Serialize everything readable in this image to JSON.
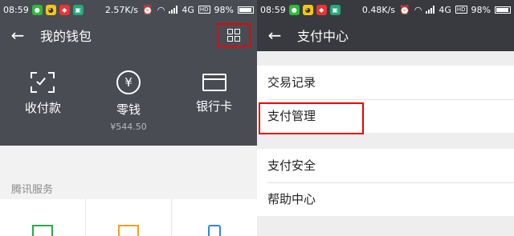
{
  "left": {
    "status": {
      "time": "08:59",
      "speed": "2.57K/s",
      "network": "4G",
      "hd": "HD",
      "battery": "98%"
    },
    "title": "我的钱包",
    "wallet": [
      {
        "label": "收付款",
        "sub": ""
      },
      {
        "label": "零钱",
        "sub": "¥544.50"
      },
      {
        "label": "银行卡",
        "sub": ""
      }
    ],
    "yuan_symbol": "¥",
    "section_label": "腾讯服务",
    "icons": {
      "status_apps": [
        "wechat-icon",
        "qq-icon",
        "app-icon",
        "scan-app-icon"
      ],
      "menu": "grid-menu-icon",
      "wallet": [
        "scan-pay-icon",
        "yuan-coin-icon",
        "bank-card-icon"
      ],
      "services": [
        "green-service-icon",
        "orange-service-icon",
        "blue-phone-icon"
      ]
    },
    "colors": {
      "header_bg": "#4a4c53",
      "highlight": "#ee0000"
    }
  },
  "right": {
    "status": {
      "time": "08:59",
      "speed": "0.48K/s",
      "network": "4G",
      "hd": "HD",
      "battery": "98%"
    },
    "title": "支付中心",
    "group1": [
      "交易记录",
      "支付管理"
    ],
    "group2": [
      "支付安全",
      "帮助中心"
    ],
    "colors": {
      "header_bg": "#393a3f",
      "highlight": "#ee0000"
    }
  }
}
